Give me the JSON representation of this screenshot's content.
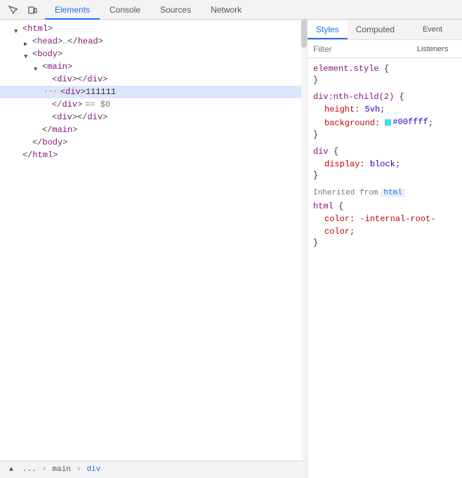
{
  "toolbar": {
    "tabs": [
      {
        "id": "elements",
        "label": "Elements",
        "active": true
      },
      {
        "id": "console",
        "label": "Console",
        "active": false
      },
      {
        "id": "sources",
        "label": "Sources",
        "active": false
      },
      {
        "id": "network",
        "label": "Network",
        "active": false
      }
    ],
    "icons": [
      {
        "id": "cursor",
        "symbol": "⬆",
        "title": "Select element"
      },
      {
        "id": "device",
        "symbol": "▭",
        "title": "Toggle device toolbar"
      }
    ]
  },
  "dom": {
    "lines": [
      {
        "indent": 1,
        "triangle": "open",
        "html": "<html>"
      },
      {
        "indent": 2,
        "triangle": "closed",
        "html": "<head>…</head>"
      },
      {
        "indent": 2,
        "triangle": "open",
        "html": "<body>"
      },
      {
        "indent": 3,
        "triangle": "open",
        "html": "<main>"
      },
      {
        "indent": 4,
        "triangle": "empty",
        "html": "<div></div>"
      },
      {
        "indent": 4,
        "triangle": "empty",
        "html": "<div>111111",
        "selected": true
      },
      {
        "indent": 4,
        "triangle": "empty",
        "html": "</div>  == $0"
      },
      {
        "indent": 4,
        "triangle": "empty",
        "html": "<div></div>"
      },
      {
        "indent": 3,
        "triangle": "empty",
        "html": "</main>"
      },
      {
        "indent": 2,
        "triangle": "empty",
        "html": "</body>"
      },
      {
        "indent": 1,
        "triangle": "empty",
        "html": "</html>"
      }
    ],
    "bottom": {
      "breadcrumbs": [
        "...",
        "main",
        "div"
      ]
    }
  },
  "styles": {
    "tabs": [
      {
        "id": "styles",
        "label": "Styles",
        "active": true
      },
      {
        "id": "computed",
        "label": "Computed",
        "active": false
      },
      {
        "id": "event-listeners",
        "label": "Event Listeners",
        "active": false
      }
    ],
    "filter_placeholder": "Filter",
    "rules": [
      {
        "selector": "element.style {",
        "close": "}",
        "properties": []
      },
      {
        "selector": "div:nth-child(2) {",
        "close": "}",
        "properties": [
          {
            "name": "height",
            "value": "5vh",
            "color": null
          },
          {
            "name": "background",
            "value": "#00ffff",
            "color": "#00ffff"
          }
        ]
      },
      {
        "selector": "div {",
        "close": "}",
        "properties": [
          {
            "name": "display",
            "value": "block",
            "color": null
          }
        ]
      }
    ],
    "inherited_from": "html",
    "inherited_rules": [
      {
        "selector": "html {",
        "close": "}",
        "properties": [
          {
            "name": "color",
            "value": "-internal-root-color",
            "color": null
          }
        ]
      }
    ]
  }
}
